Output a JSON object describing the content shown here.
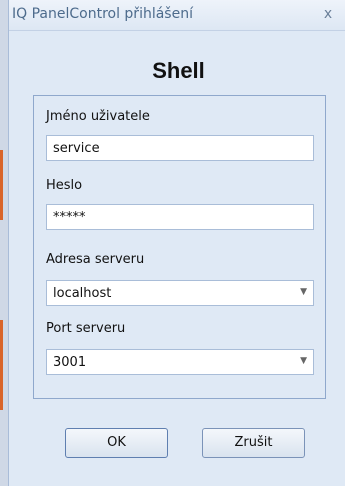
{
  "window": {
    "title": "IQ PanelControl přihlášení",
    "close_glyph": "x"
  },
  "heading": "Shell",
  "form": {
    "username": {
      "label": "Jméno uživatele",
      "value": "service"
    },
    "password": {
      "label": "Heslo",
      "value": "*****"
    },
    "server_address": {
      "label": "Adresa serveru",
      "value": "localhost"
    },
    "server_port": {
      "label": "Port serveru",
      "value": "3001"
    }
  },
  "buttons": {
    "ok": "OK",
    "cancel": "Zrušit"
  },
  "icons": {
    "dropdown": "chevron-down-icon",
    "close": "close-icon"
  },
  "colors": {
    "window_bg": "#dfe9f5",
    "panel_border": "#8fa8cc",
    "title_text": "#4d6b8c"
  }
}
